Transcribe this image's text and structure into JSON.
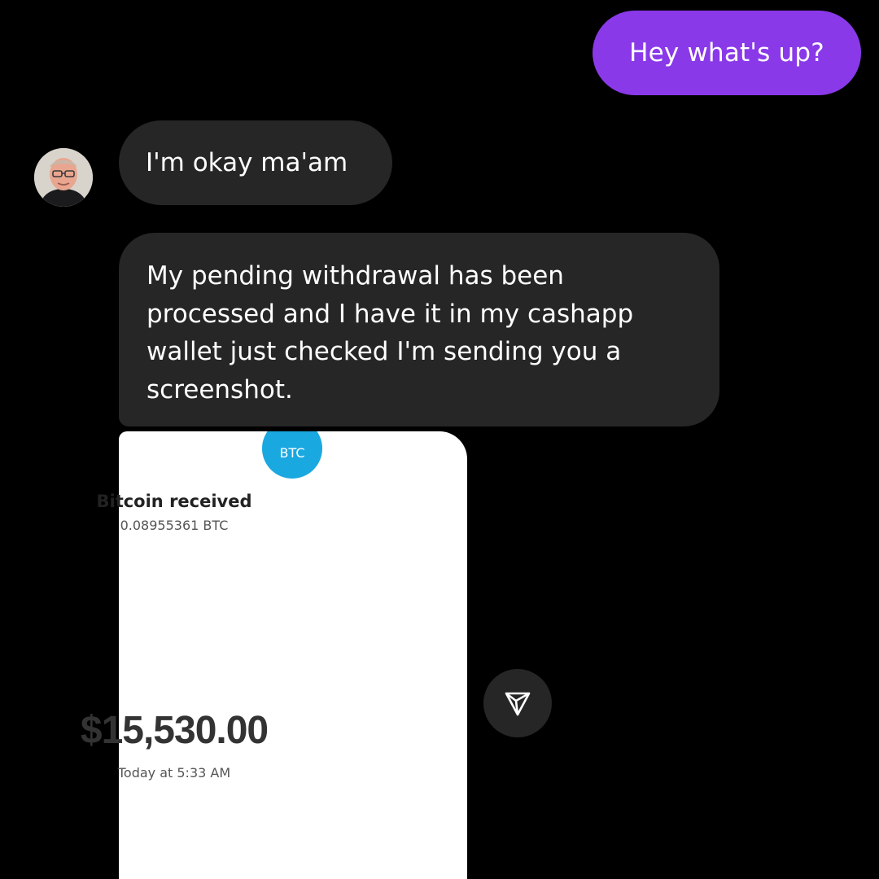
{
  "colors": {
    "background": "#000000",
    "outgoing_bubble": "#8a39e9",
    "incoming_bubble": "#262627",
    "btc_badge": "#1aa8e0",
    "text_light": "#ffffff"
  },
  "messages": {
    "outgoing_1": "Hey what's up?",
    "incoming_1": "I'm okay ma'am",
    "incoming_2": "My pending withdrawal has been processed and I have it in my cashapp wallet just checked I'm sending you a screenshot."
  },
  "shared_screenshot": {
    "badge": "BTC",
    "title": "Bitcoin received",
    "btc_amount": "0.08955361 BTC",
    "usd_amount": "$15,530.00",
    "timestamp": "Today at 5:33 AM"
  },
  "icons": {
    "share": "paper-plane-icon",
    "avatar": "avatar"
  }
}
